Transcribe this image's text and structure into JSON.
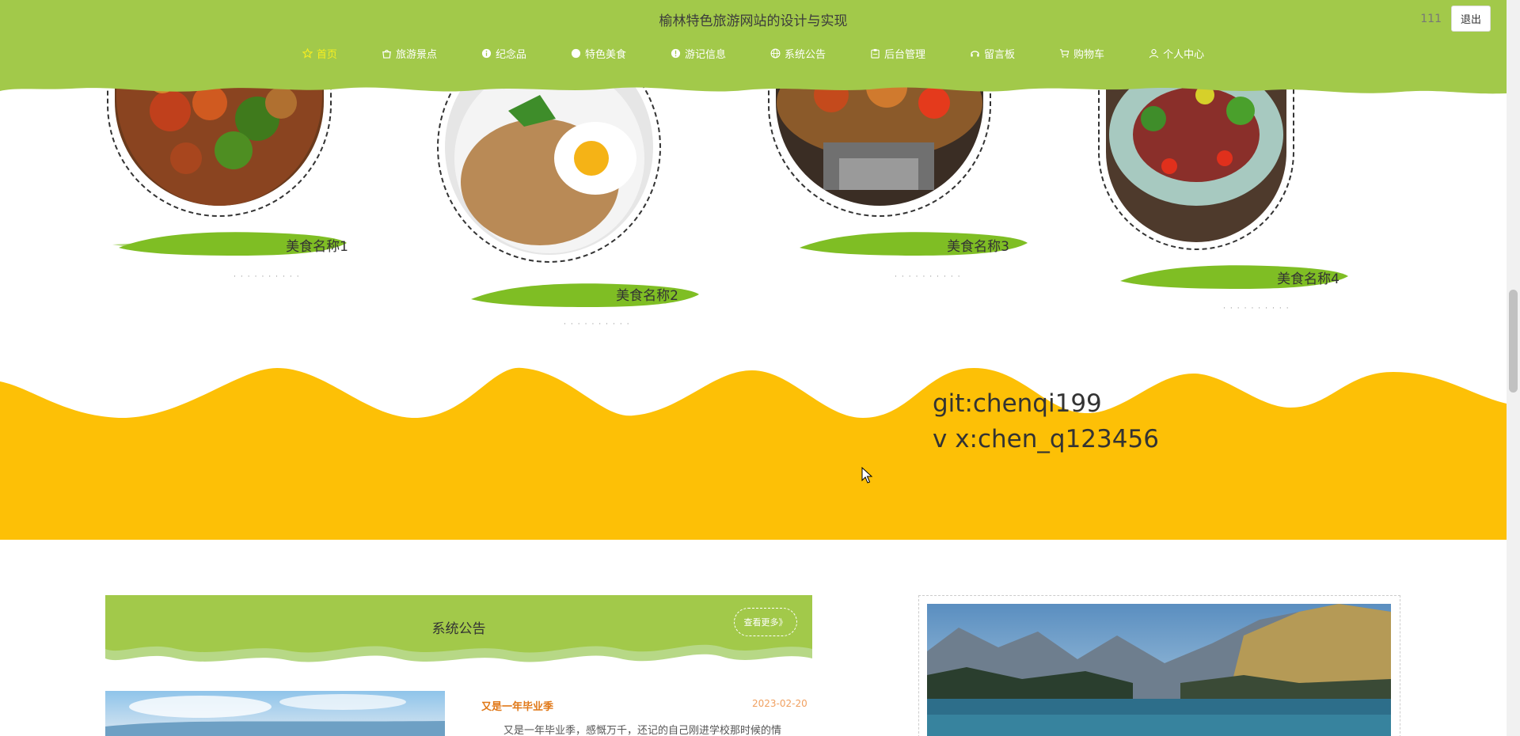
{
  "header": {
    "site_title": "榆林特色旅游网站的设计与实现",
    "username": "111",
    "logout_label": "退出",
    "nav": [
      {
        "label": "首页",
        "icon": "star-icon",
        "active": true
      },
      {
        "label": "旅游景点",
        "icon": "bag-icon",
        "active": false
      },
      {
        "label": "纪念品",
        "icon": "info-circle-icon",
        "active": false
      },
      {
        "label": "特色美食",
        "icon": "circle-icon",
        "active": false
      },
      {
        "label": "游记信息",
        "icon": "info-circle-icon",
        "active": false
      },
      {
        "label": "系统公告",
        "icon": "globe-icon",
        "active": false
      },
      {
        "label": "后台管理",
        "icon": "clipboard-icon",
        "active": false
      },
      {
        "label": "留言板",
        "icon": "headset-icon",
        "active": false
      },
      {
        "label": "购物车",
        "icon": "cart-icon",
        "active": false
      },
      {
        "label": "个人中心",
        "icon": "user-icon",
        "active": false
      }
    ]
  },
  "foods": [
    {
      "name": "美食名称1"
    },
    {
      "name": "美食名称2"
    },
    {
      "name": "美食名称3"
    },
    {
      "name": "美食名称4"
    }
  ],
  "band": {
    "line1": "git:chenqi199",
    "line2": "v x:chen_q123456"
  },
  "notice": {
    "title": "系统公告",
    "more_label": "查看更多》",
    "item_title": "又是一年毕业季",
    "item_date": "2023-02-20",
    "item_summary": "又是一年毕业季，感慨万千，还记的自己刚进学校那时候的情"
  },
  "colors": {
    "header_green": "#a2c94a",
    "nav_active": "#f7ee20",
    "band_yellow": "#fdc006",
    "brush_green": "#7fbe24",
    "notice_orange": "#e07818"
  }
}
